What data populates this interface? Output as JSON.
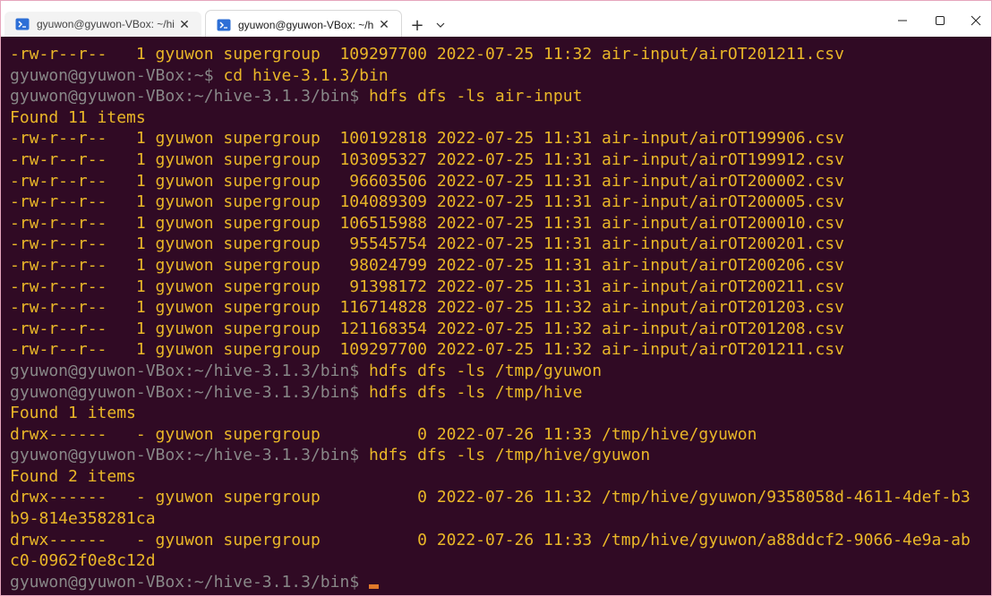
{
  "tabs": [
    {
      "title": "gyuwon@gyuwon-VBox: ~/hiv",
      "active": false,
      "icon": "terminal-icon"
    },
    {
      "title": "gyuwon@gyuwon-VBox: ~/h",
      "active": true,
      "icon": "terminal-icon"
    }
  ],
  "tabbar": {
    "add_label": "+",
    "close_glyph": "✕"
  },
  "colors": {
    "background": "#300a24",
    "output": "#eab728",
    "prompt": "#888888",
    "cursor": "#e0792a",
    "window_border": "#e6a6bd"
  },
  "prompt": {
    "user_host": "gyuwon@gyuwon-VBox",
    "colon": ":",
    "dollar": "$"
  },
  "terminal_lines": [
    {
      "type": "output",
      "text": "-rw-r--r--   1 gyuwon supergroup  109297700 2022-07-25 11:32 air-input/airOT201211.csv"
    },
    {
      "type": "prompt",
      "path": "~",
      "command": " cd hive-3.1.3/bin"
    },
    {
      "type": "prompt",
      "path": "~/hive-3.1.3/bin",
      "command": " hdfs dfs -ls air-input"
    },
    {
      "type": "output",
      "text": "Found 11 items"
    },
    {
      "type": "output",
      "text": "-rw-r--r--   1 gyuwon supergroup  100192818 2022-07-25 11:31 air-input/airOT199906.csv"
    },
    {
      "type": "output",
      "text": "-rw-r--r--   1 gyuwon supergroup  103095327 2022-07-25 11:31 air-input/airOT199912.csv"
    },
    {
      "type": "output",
      "text": "-rw-r--r--   1 gyuwon supergroup   96603506 2022-07-25 11:31 air-input/airOT200002.csv"
    },
    {
      "type": "output",
      "text": "-rw-r--r--   1 gyuwon supergroup  104089309 2022-07-25 11:31 air-input/airOT200005.csv"
    },
    {
      "type": "output",
      "text": "-rw-r--r--   1 gyuwon supergroup  106515988 2022-07-25 11:31 air-input/airOT200010.csv"
    },
    {
      "type": "output",
      "text": "-rw-r--r--   1 gyuwon supergroup   95545754 2022-07-25 11:31 air-input/airOT200201.csv"
    },
    {
      "type": "output",
      "text": "-rw-r--r--   1 gyuwon supergroup   98024799 2022-07-25 11:31 air-input/airOT200206.csv"
    },
    {
      "type": "output",
      "text": "-rw-r--r--   1 gyuwon supergroup   91398172 2022-07-25 11:31 air-input/airOT200211.csv"
    },
    {
      "type": "output",
      "text": "-rw-r--r--   1 gyuwon supergroup  116714828 2022-07-25 11:32 air-input/airOT201203.csv"
    },
    {
      "type": "output",
      "text": "-rw-r--r--   1 gyuwon supergroup  121168354 2022-07-25 11:32 air-input/airOT201208.csv"
    },
    {
      "type": "output",
      "text": "-rw-r--r--   1 gyuwon supergroup  109297700 2022-07-25 11:32 air-input/airOT201211.csv"
    },
    {
      "type": "prompt",
      "path": "~/hive-3.1.3/bin",
      "command": " hdfs dfs -ls /tmp/gyuwon"
    },
    {
      "type": "prompt",
      "path": "~/hive-3.1.3/bin",
      "command": " hdfs dfs -ls /tmp/hive"
    },
    {
      "type": "output",
      "text": "Found 1 items"
    },
    {
      "type": "output",
      "text": "drwx------   - gyuwon supergroup          0 2022-07-26 11:33 /tmp/hive/gyuwon"
    },
    {
      "type": "prompt",
      "path": "~/hive-3.1.3/bin",
      "command": " hdfs dfs -ls /tmp/hive/gyuwon"
    },
    {
      "type": "output",
      "text": "Found 2 items"
    },
    {
      "type": "output",
      "text": "drwx------   - gyuwon supergroup          0 2022-07-26 11:32 /tmp/hive/gyuwon/9358058d-4611-4def-b3"
    },
    {
      "type": "output",
      "text": "b9-814e358281ca"
    },
    {
      "type": "output",
      "text": "drwx------   - gyuwon supergroup          0 2022-07-26 11:33 /tmp/hive/gyuwon/a88ddcf2-9066-4e9a-ab"
    },
    {
      "type": "output",
      "text": "c0-0962f0e8c12d"
    },
    {
      "type": "prompt",
      "path": "~/hive-3.1.3/bin",
      "command": "",
      "cursor": true
    }
  ]
}
